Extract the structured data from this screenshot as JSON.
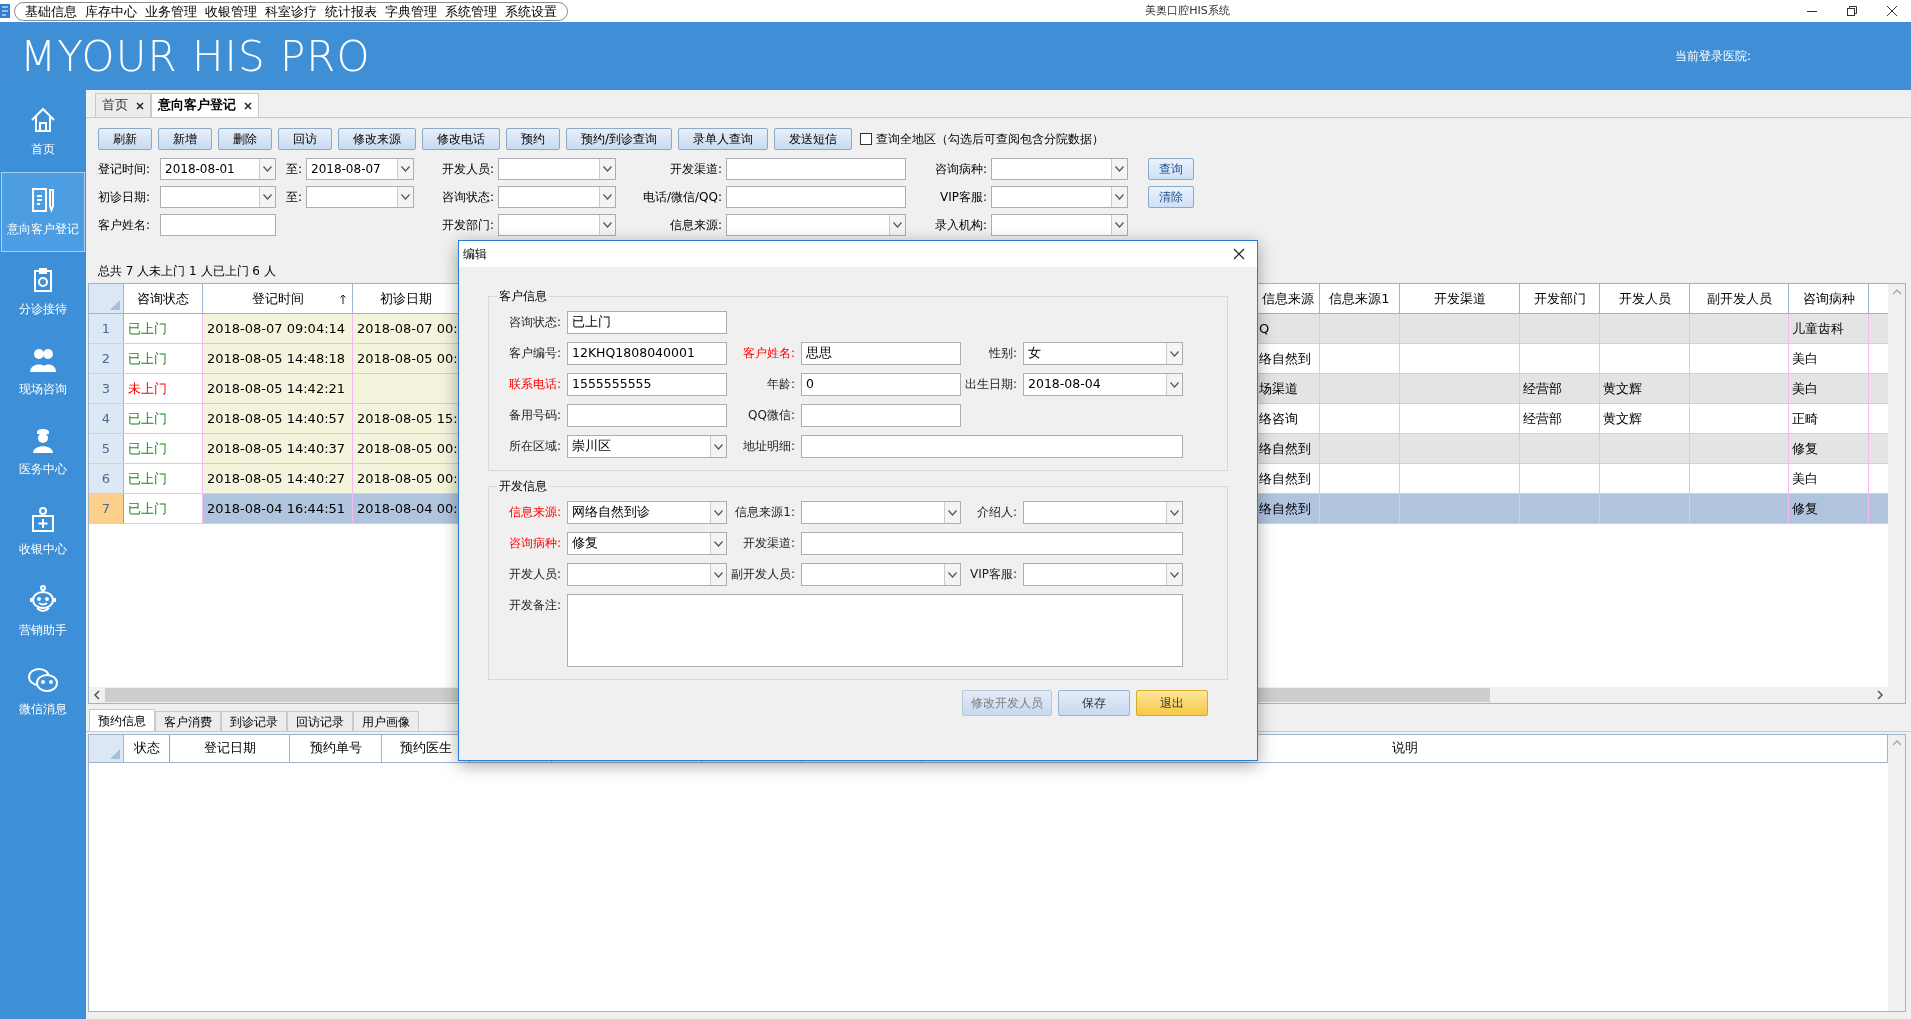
{
  "menu": [
    "基础信息",
    "库存中心",
    "业务管理",
    "收银管理",
    "科室诊疗",
    "统计报表",
    "字典管理",
    "系统管理",
    "系统设置"
  ],
  "window": {
    "title": "美奥口腔HIS系统"
  },
  "header": {
    "logo": "MYOUR HIS PRO",
    "login_label": "当前登录医院:"
  },
  "sidebar": {
    "items": [
      {
        "label": "首页",
        "selected": false
      },
      {
        "label": "意向客户登记",
        "selected": true
      },
      {
        "label": "分诊接待",
        "selected": false
      },
      {
        "label": "现场咨询",
        "selected": false
      },
      {
        "label": "医务中心",
        "selected": false
      },
      {
        "label": "收银中心",
        "selected": false
      },
      {
        "label": "营销助手",
        "selected": false
      },
      {
        "label": "微信消息",
        "selected": false
      }
    ]
  },
  "tabs": [
    {
      "label": "首页",
      "selected": false
    },
    {
      "label": "意向客户登记",
      "selected": true
    }
  ],
  "toolbar": {
    "buttons": [
      "刷新",
      "新增",
      "删除",
      "回访",
      "修改来源",
      "修改电话",
      "预约",
      "预约/到诊查询",
      "录单人查询",
      "发送短信"
    ],
    "checkbox": {
      "label": "查询全地区（勾选后可查阅包含分院数据）",
      "checked": false
    }
  },
  "filters": {
    "rows": [
      [
        {
          "label": "登记时间:",
          "kind": "select",
          "value": "2018-08-01"
        },
        {
          "label": "至:",
          "kind": "select",
          "value": "2018-08-07"
        },
        {
          "label": "开发人员:",
          "kind": "select"
        },
        {
          "label": "开发渠道:",
          "kind": "text"
        },
        {
          "label": "咨询病种:",
          "kind": "select"
        },
        {
          "label": "查询",
          "kind": "button"
        }
      ],
      [
        {
          "label": "初诊日期:",
          "kind": "select"
        },
        {
          "label": "至:",
          "kind": "select"
        },
        {
          "label": "咨询状态:",
          "kind": "select"
        },
        {
          "label": "电话/微信/QQ:",
          "kind": "text"
        },
        {
          "label": "VIP客服:",
          "kind": "select"
        },
        {
          "label": "清除",
          "kind": "button"
        }
      ],
      [
        {
          "label": "客户姓名:",
          "kind": "text"
        },
        {
          "kind": "blank"
        },
        {
          "label": "开发部门:",
          "kind": "select"
        },
        {
          "label": "信息来源:",
          "kind": "select"
        },
        {
          "label": "录入机构:",
          "kind": "select"
        }
      ]
    ]
  },
  "summary": "总共 7 人未上门 1 人已上门 6 人",
  "grid": {
    "columns_left": [
      "咨询状态",
      "登记时间",
      "初诊日期"
    ],
    "columns_right": [
      "信息来源",
      "信息来源1",
      "开发渠道",
      "开发部门",
      "开发人员",
      "副开发人员",
      "咨询病种"
    ],
    "rows": [
      {
        "no": "1",
        "status": "已上门",
        "visited": true,
        "registered": "2018-08-07 09:04:14",
        "first_visit": "2018-08-07 00:",
        "source": "Q",
        "disease": "儿童齿科",
        "selected": false
      },
      {
        "no": "2",
        "status": "已上门",
        "visited": true,
        "registered": "2018-08-05 14:48:18",
        "first_visit": "2018-08-05 00:",
        "source": "络自然到",
        "disease": "美白",
        "selected": false
      },
      {
        "no": "3",
        "status": "未上门",
        "visited": false,
        "registered": "2018-08-05 14:42:21",
        "source": "场渠道",
        "dept": "经营部",
        "developer": "黄文辉",
        "disease": "美白",
        "selected": false
      },
      {
        "no": "4",
        "status": "已上门",
        "visited": true,
        "registered": "2018-08-05 14:40:57",
        "first_visit": "2018-08-05 15:",
        "source": "络咨询",
        "dept": "经营部",
        "developer": "黄文辉",
        "disease": "正畸",
        "selected": false
      },
      {
        "no": "5",
        "status": "已上门",
        "visited": true,
        "registered": "2018-08-05 14:40:37",
        "first_visit": "2018-08-05 00:",
        "source": "络自然到",
        "disease": "修复",
        "selected": false
      },
      {
        "no": "6",
        "status": "已上门",
        "visited": true,
        "registered": "2018-08-05 14:40:27",
        "first_visit": "2018-08-05 00:",
        "source": "络自然到",
        "disease": "美白",
        "selected": false
      },
      {
        "no": "7",
        "status": "已上门",
        "visited": true,
        "registered": "2018-08-04 16:44:51",
        "first_visit": "2018-08-04 00:",
        "source": "络自然到",
        "disease": "修复",
        "selected": true
      }
    ]
  },
  "detail": {
    "tabs": [
      {
        "label": "预约信息",
        "selected": true
      },
      {
        "label": "客户消费",
        "selected": false
      },
      {
        "label": "到诊记录",
        "selected": false
      },
      {
        "label": "回访记录",
        "selected": false
      },
      {
        "label": "用户画像",
        "selected": false
      }
    ],
    "columns": [
      "状态",
      "登记日期",
      "预约单号",
      "预约医生",
      "说明"
    ]
  },
  "dialog": {
    "title": "编辑",
    "groups": [
      {
        "title": "客户信息",
        "rows": [
          [
            {
              "label": "咨询状态:",
              "kind": "text",
              "value": "已上门",
              "required": false
            }
          ],
          [
            {
              "label": "客户编号:",
              "kind": "text",
              "value": "12KHQ1808040001",
              "required": false
            },
            {
              "label": "客户姓名:",
              "kind": "text",
              "value": "思思",
              "required": true
            },
            {
              "label": "性别:",
              "kind": "select",
              "value": "女",
              "required": false
            }
          ],
          [
            {
              "label": "联系电话:",
              "kind": "text",
              "value": "1555555555",
              "required": true
            },
            {
              "label": "年龄:",
              "kind": "text",
              "value": "0",
              "required": false
            },
            {
              "label": "出生日期:",
              "kind": "select",
              "value": "2018-08-04",
              "required": false
            }
          ],
          [
            {
              "label": "备用号码:",
              "kind": "text",
              "required": false
            },
            {
              "label": "QQ微信:",
              "kind": "text",
              "required": false
            }
          ],
          [
            {
              "label": "所在区域:",
              "kind": "select",
              "value": "崇川区",
              "required": false
            },
            {
              "label": "地址明细:",
              "kind": "text",
              "required": false,
              "wide": true
            }
          ]
        ]
      },
      {
        "title": "开发信息",
        "rows": [
          [
            {
              "label": "信息来源:",
              "kind": "select",
              "value": "网络自然到诊",
              "required": true
            },
            {
              "label": "信息来源1:",
              "kind": "select",
              "required": false
            },
            {
              "label": "介绍人:",
              "kind": "select",
              "required": false
            }
          ],
          [
            {
              "label": "咨询病种:",
              "kind": "select",
              "value": "修复",
              "required": true
            },
            {
              "label": "开发渠道:",
              "kind": "text",
              "required": false,
              "wide": true
            }
          ],
          [
            {
              "label": "开发人员:",
              "kind": "select",
              "required": false
            },
            {
              "label": "副开发人员:",
              "kind": "select",
              "required": false
            },
            {
              "label": "VIP客服:",
              "kind": "select",
              "required": false
            }
          ],
          [
            {
              "label": "开发备注:",
              "kind": "textarea",
              "required": false
            }
          ]
        ]
      }
    ],
    "buttons": [
      {
        "label": "修改开发人员",
        "kind": "default",
        "disabled": true
      },
      {
        "label": "保存",
        "kind": "default",
        "disabled": false
      },
      {
        "label": "退出",
        "kind": "exit",
        "disabled": false
      }
    ]
  }
}
